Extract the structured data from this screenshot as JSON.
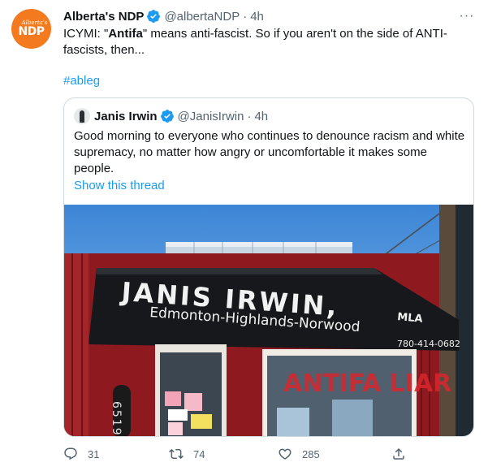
{
  "tweet": {
    "avatar": {
      "top_text": "Alberta's",
      "bottom_text": "NDP",
      "color": "#f47a20"
    },
    "author_name": "Alberta's NDP",
    "handle": "@albertaNDP",
    "separator": "·",
    "time": "4h",
    "more_label": "···",
    "text_prefix": "ICYMI: \"",
    "text_bold": "Antifa",
    "text_suffix": "\" means anti-fascist. So if you aren't on the side of ANTI-fascists, then...",
    "hashtag": "#ableg"
  },
  "quote": {
    "author_name": "Janis Irwin",
    "handle": "@JanisIrwin",
    "separator": "·",
    "time": "4h",
    "text": "Good morning to everyone who continues to denounce racism and white supremacy, no matter how angry or uncomfortable it makes some people.",
    "show_thread": "Show this thread",
    "photo": {
      "sign_name": "JANIS IRWIN,",
      "sign_title": "MLA",
      "sign_riding": "Edmonton-Highlands-Norwood",
      "sign_phone": "780-414-0682",
      "address_number": "6519",
      "graffiti": "ANTIFA LIAR"
    }
  },
  "actions": {
    "reply_count": "31",
    "retweet_count": "74",
    "like_count": "",
    "share_count": "285"
  },
  "colors": {
    "accent": "#1d9bf0",
    "muted": "#536471",
    "border": "#cfd9de",
    "verified": "#1d9bf0"
  }
}
